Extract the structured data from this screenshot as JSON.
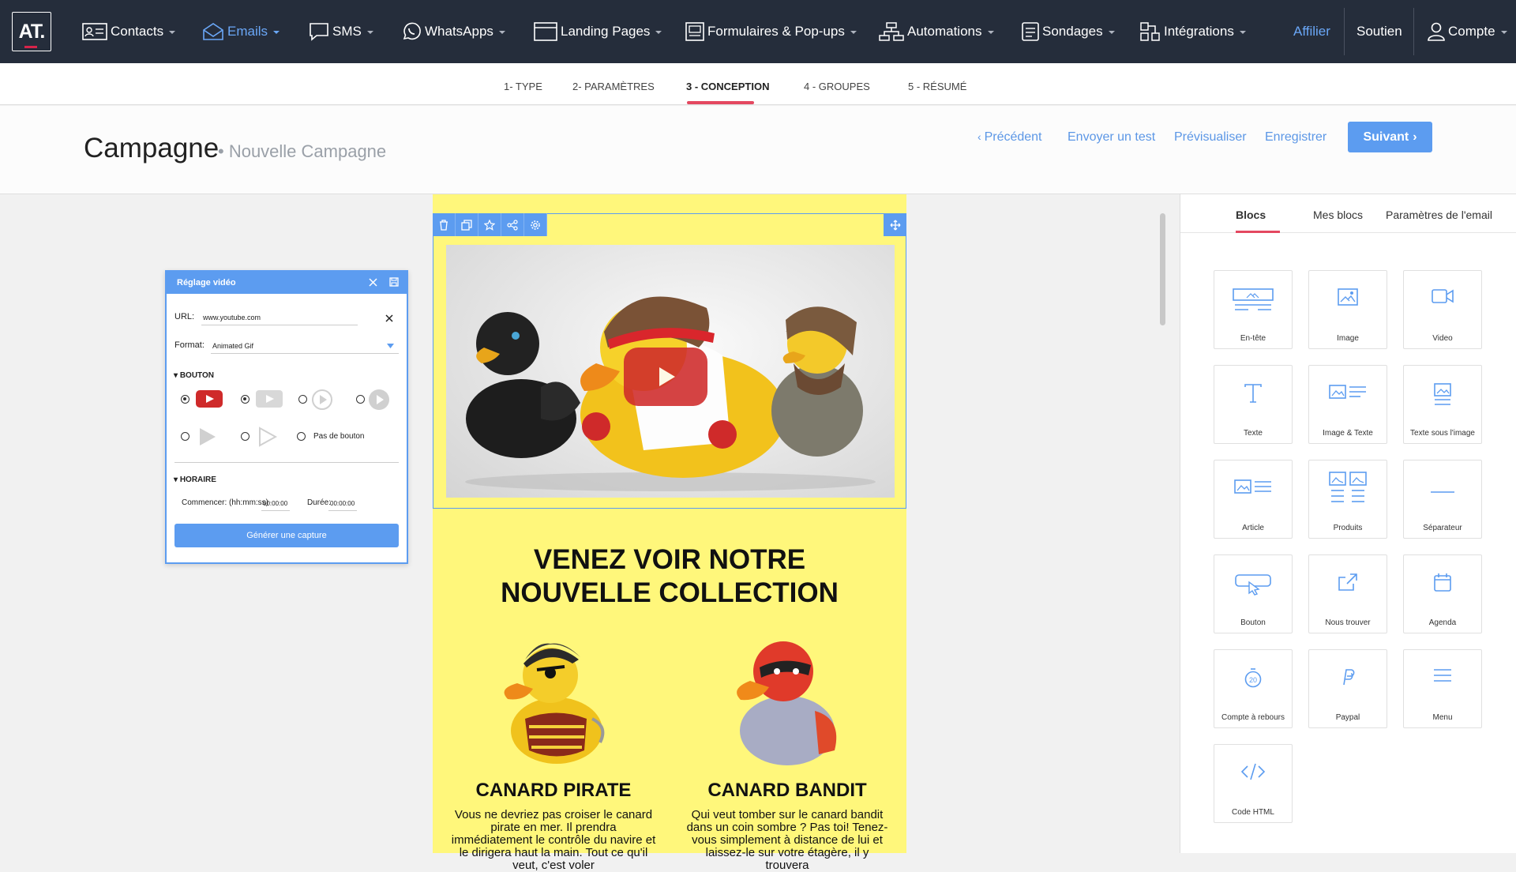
{
  "nav": {
    "logo": "AT.",
    "items": [
      {
        "label": "Contacts",
        "icon": "contacts-icon"
      },
      {
        "label": "Emails",
        "icon": "envelope-icon"
      },
      {
        "label": "SMS",
        "icon": "chat-bubble-icon"
      },
      {
        "label": "WhatsApps",
        "icon": "whatsapp-icon"
      },
      {
        "label": "Landing Pages",
        "icon": "browser-window-icon"
      },
      {
        "label": "Formulaires & Pop-ups",
        "icon": "form-icon"
      },
      {
        "label": "Automations",
        "icon": "workflow-icon"
      },
      {
        "label": "Sondages",
        "icon": "survey-icon"
      },
      {
        "label": "Intégrations",
        "icon": "integrations-icon"
      }
    ],
    "affilier": "Affilier",
    "soutien": "Soutien",
    "compte": "Compte",
    "accent": "#6aa7f7"
  },
  "steps": [
    "1- TYPE",
    "2- PARAMÈTRES",
    "3 - CONCEPTION",
    "4 - GROUPES",
    "5 - RÉSUMÉ"
  ],
  "header": {
    "title": "Campagne",
    "subtitle": "• Nouvelle Campagne",
    "prev": "Précédent",
    "test": "Envoyer un test",
    "preview": "Prévisualiser",
    "save": "Enregistrer",
    "next": "Suivant"
  },
  "email": {
    "background": "#fff77b",
    "title_line1": "VENEZ VOIR NOTRE",
    "title_line2": "NOUVELLE COLLECTION",
    "products": [
      {
        "name": "CANARD PIRATE",
        "desc": "Vous ne devriez pas croiser le canard pirate en mer. Il prendra immédiatement le contrôle du navire et le dirigera haut la main. Tout ce qu'il veut, c'est voler"
      },
      {
        "name": "CANARD BANDIT",
        "desc": "Qui veut tomber sur le canard bandit dans un coin sombre ? Pas toi! Tenez-vous simplement à distance de lui et laissez-le sur votre étagère, il y trouvera"
      }
    ]
  },
  "toolbar_icons": [
    "trash-icon",
    "duplicate-icon",
    "star-icon",
    "share-icon",
    "gear-icon"
  ],
  "panel": {
    "tabs": [
      "Blocs",
      "Mes blocs",
      "Paramètres de l'email"
    ],
    "blocks": [
      {
        "label": "En-tête",
        "icon": "header-block-icon"
      },
      {
        "label": "Image",
        "icon": "image-block-icon"
      },
      {
        "label": "Video",
        "icon": "video-block-icon"
      },
      {
        "label": "Texte",
        "icon": "text-block-icon"
      },
      {
        "label": "Image & Texte",
        "icon": "image-text-block-icon"
      },
      {
        "label": "Texte sous l'image",
        "icon": "text-under-image-icon"
      },
      {
        "label": "Article",
        "icon": "article-block-icon"
      },
      {
        "label": "Produits",
        "icon": "products-block-icon"
      },
      {
        "label": "Séparateur",
        "icon": "separator-block-icon"
      },
      {
        "label": "Bouton",
        "icon": "button-block-icon"
      },
      {
        "label": "Nous trouver",
        "icon": "find-us-icon"
      },
      {
        "label": "Agenda",
        "icon": "calendar-icon"
      },
      {
        "label": "Compte à rebours",
        "icon": "countdown-icon"
      },
      {
        "label": "Paypal",
        "icon": "paypal-icon"
      },
      {
        "label": "Menu",
        "icon": "menu-icon"
      },
      {
        "label": "Code HTML",
        "icon": "code-icon"
      }
    ]
  },
  "video_modal": {
    "title": "Réglage vidéo",
    "url_label": "URL:",
    "url_value": "www.youtube.com",
    "format_label": "Format:",
    "format_value": "Animated Gif",
    "button_section": "BOUTON",
    "no_button": "Pas de bouton",
    "schedule_section": "HORAIRE",
    "start_label": "Commencer: (hh:mm:ss)",
    "start_value": "00:00:00",
    "duration_label": "Durée:",
    "duration_value": "00:00:00",
    "generate": "Générer une capture"
  }
}
